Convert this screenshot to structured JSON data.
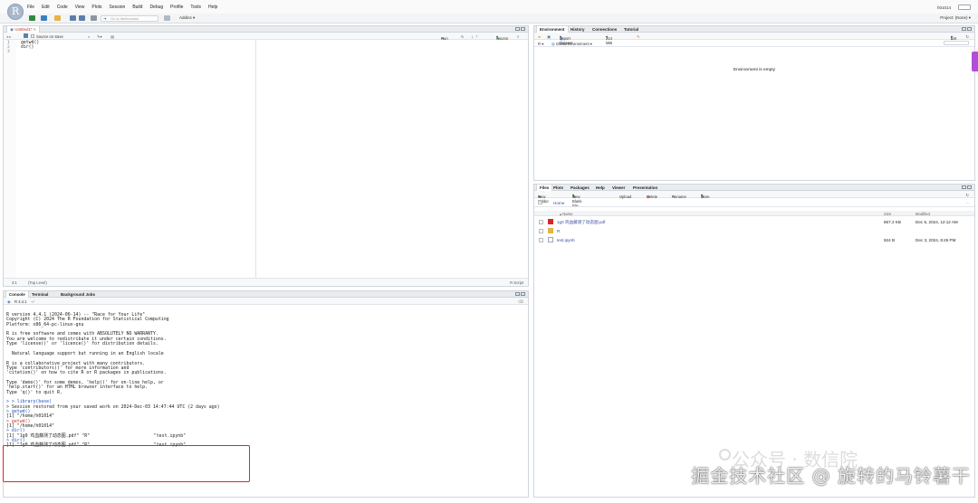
{
  "menu": [
    "File",
    "Edit",
    "Code",
    "View",
    "Plots",
    "Session",
    "Build",
    "Debug",
    "Profile",
    "Tools",
    "Help"
  ],
  "user": "h01014",
  "toolbar": {
    "goto_placeholder": "Go to file/function",
    "addins": "Addins",
    "project": "Project: (None)"
  },
  "source": {
    "tab_label": "Untitled1*",
    "save_on_source": "Source on Save",
    "run": "Run",
    "source_btn": "Source",
    "lines": [
      {
        "n": "1",
        "code": "getwd()"
      },
      {
        "n": "2",
        "code": "dir()"
      },
      {
        "n": "3",
        "code": ""
      }
    ],
    "status_pos": "3:1",
    "status_level": "(Top Level)",
    "status_type": "R Script"
  },
  "console": {
    "tabs": [
      "Console",
      "Terminal",
      "Background Jobs"
    ],
    "version_label": "R 4.4.1",
    "path": "~/",
    "lines": [
      {
        "t": "R version 4.4.1 (2024-06-14) -- \"Race for Your Life\"",
        "k": "out"
      },
      {
        "t": "Copyright (C) 2024 The R Foundation for Statistical Computing",
        "k": "out"
      },
      {
        "t": "Platform: x86_64-pc-linux-gnu",
        "k": "out"
      },
      {
        "t": "",
        "k": "out"
      },
      {
        "t": "R is free software and comes with ABSOLUTELY NO WARRANTY.",
        "k": "out"
      },
      {
        "t": "You are welcome to redistribute it under certain conditions.",
        "k": "out"
      },
      {
        "t": "Type 'license()' or 'licence()' for distribution details.",
        "k": "out"
      },
      {
        "t": "",
        "k": "out"
      },
      {
        "t": "  Natural language support but running in an English locale",
        "k": "out"
      },
      {
        "t": "",
        "k": "out"
      },
      {
        "t": "R is a collaborative project with many contributors.",
        "k": "out"
      },
      {
        "t": "Type 'contributors()' for more information and",
        "k": "out"
      },
      {
        "t": "'citation()' on how to cite R or R packages in publications.",
        "k": "out"
      },
      {
        "t": "",
        "k": "out"
      },
      {
        "t": "Type 'demo()' for some demos, 'help()' for on-line help, or",
        "k": "out"
      },
      {
        "t": "'help.start()' for an HTML browser interface to help.",
        "k": "out"
      },
      {
        "t": "Type 'q()' to quit R.",
        "k": "out"
      },
      {
        "t": "",
        "k": "out"
      },
      {
        "t": "> > library(base)",
        "k": "in"
      },
      {
        "t": "> Session restored from your saved work on 2024-Dec-03 14:47:44 UTC (2 days ago)",
        "k": "out"
      },
      {
        "t": "> getwd()",
        "k": "in"
      },
      {
        "t": "[1] \"/home/h01014\"",
        "k": "out"
      },
      {
        "t": "> getwd()",
        "k": "err"
      },
      {
        "t": "[1] \"/home/h01014\"",
        "k": "out"
      },
      {
        "t": "> dir()",
        "k": "in"
      },
      {
        "t": "[1] \"1g0 鸡血藤测了动态图.pdf\" \"R\"                        \"test.ipynb\"",
        "k": "out"
      },
      {
        "t": "> dir()",
        "k": "in"
      },
      {
        "t": "[1] \"1g0 鸡血藤测了动态图.pdf\" \"R\"                        \"test.ipynb\"",
        "k": "out"
      }
    ]
  },
  "environment": {
    "tabs": [
      "Environment",
      "History",
      "Connections",
      "Tutorial"
    ],
    "import": "Import Dataset",
    "memory": "214 MiB",
    "list_view": "List",
    "lang": "R",
    "scope": "Global Environment",
    "empty_msg": "Environment is empty"
  },
  "files": {
    "tabs": [
      "Files",
      "Plots",
      "Packages",
      "Help",
      "Viewer",
      "Presentation"
    ],
    "actions": [
      "New Folder",
      "New Blank File",
      "Upload",
      "Delete",
      "Rename",
      "More"
    ],
    "breadcrumb": "Home",
    "headers": {
      "name": "Name",
      "size": "Size",
      "modified": "Modified"
    },
    "rows": [
      {
        "name": "1g0 鸡血藤测了动态图.pdf",
        "size": "867.2 KB",
        "modified": "Dec 5, 2024, 12:12 AM",
        "icon": "pdf-icon"
      },
      {
        "name": "R",
        "size": "",
        "modified": "",
        "icon": "folder-icon"
      },
      {
        "name": "test.ipynb",
        "size": "924 B",
        "modified": "Dec 3, 2024, 8:45 PM",
        "icon": "file-icon"
      }
    ]
  },
  "watermark": {
    "main": "掘金技术社区 @ 旋转的马铃薯干",
    "sub": "公众号 · 数信院"
  },
  "colors": {
    "accent": "#4a78b5",
    "highlight": "#d8262a",
    "input": "#1f4fbf"
  }
}
